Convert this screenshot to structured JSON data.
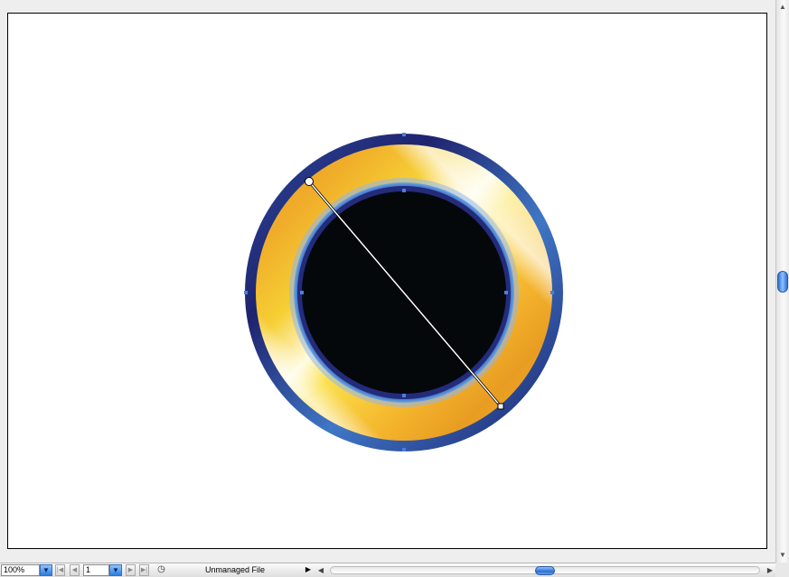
{
  "statusbar": {
    "zoom": "100%",
    "zoom_dropdown_icon": "triangle-down",
    "first_page_icon": "first-page",
    "prev_page_icon": "prev-page",
    "page": "1",
    "page_dropdown_icon": "triangle-down",
    "next_page_icon": "next-page",
    "last_page_icon": "last-page",
    "status_icon": "status-circle",
    "status_text": "Unmanaged File",
    "status_menu_icon": "triangle-right"
  },
  "colors": {
    "outer_ring": "#1f236e",
    "gold_ring_dark": "#e8a324",
    "gold_ring_light": "#fff3a6",
    "inner_ring": "#26307f",
    "inner_disc": "#04080b",
    "gradient_line": "#ffffff",
    "anchor_point": "#4a7ee0",
    "scroll_thumb": "#2e6fd0"
  }
}
